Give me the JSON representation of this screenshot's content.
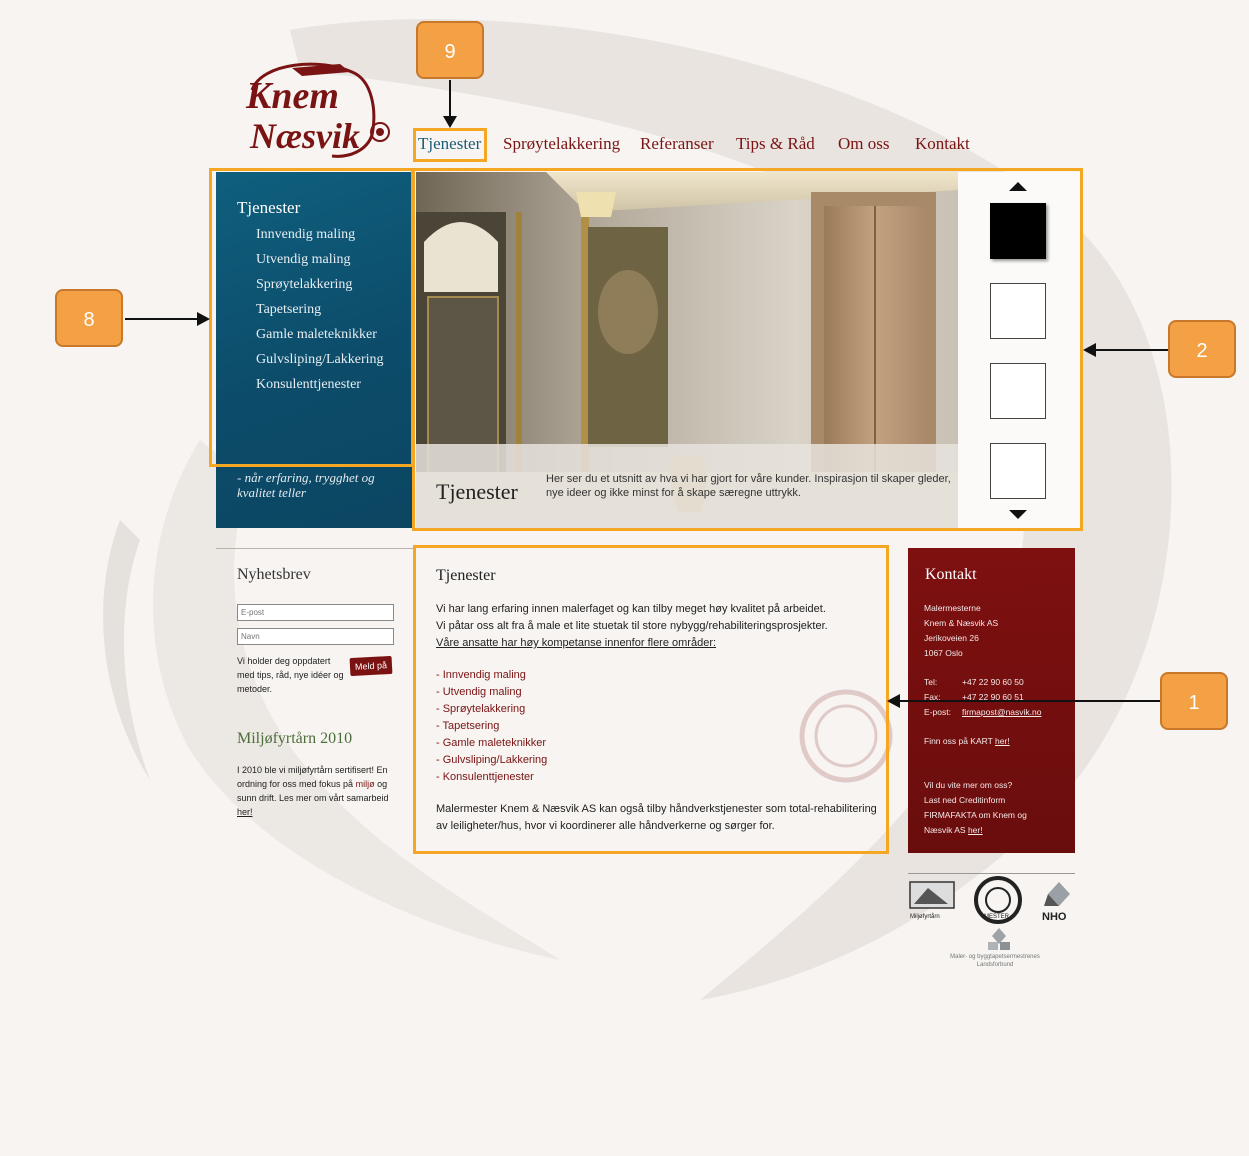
{
  "brand": {
    "logo_line1": "Knem",
    "logo_line2": "Næsvik"
  },
  "nav": [
    {
      "label": "Tjenester",
      "active": true
    },
    {
      "label": "Sprøytelakkering"
    },
    {
      "label": "Referanser"
    },
    {
      "label": "Tips & Råd"
    },
    {
      "label": "Om oss"
    },
    {
      "label": "Kontakt"
    }
  ],
  "sidenav": {
    "title": "Tjenester",
    "items": [
      "Innvendig maling",
      "Utvendig maling",
      "Sprøytelakkering",
      "Tapetsering",
      "Gamle maleteknikker",
      "Gulvsliping/Lakkering",
      "Konsulenttjenester"
    ],
    "tagline": "- når erfaring, trygghet og kvalitet teller"
  },
  "hero": {
    "title": "Tjenester",
    "text": "Her ser du et utsnitt av hva vi har gjort for våre kunder. Inspirasjon til skaper gleder, nye ideer og ikke minst for å skape særegne uttrykk."
  },
  "newsletter": {
    "title": "Nyhetsbrev",
    "email_placeholder": "E-post",
    "name_placeholder": "Navn",
    "text": "Vi holder deg oppdatert med tips, råd, nye idéer og metoder.",
    "button": "Meld på"
  },
  "eco": {
    "title": "Miljøfyrtårn 2010",
    "text_a": "I 2010 ble vi miljøfyrtårn sertifisert! En ordning for oss med fokus på",
    "link_a": "miljø",
    "text_b": "og sunn drift. Les mer om vårt samarbeid",
    "link_b": "her!"
  },
  "main": {
    "title": "Tjenester",
    "intro1": "Vi har lang erfaring innen malerfaget og kan tilby meget høy kvalitet på arbeidet.",
    "intro2": "Vi påtar oss alt fra å male et lite stuetak til store nybygg/rehabiliteringsprosjekter.",
    "intro3": "Våre ansatte har høy kompetanse innenfor flere områder:",
    "list": [
      "- Innvendig maling",
      "- Utvendig maling",
      "- Sprøytelakkering",
      "- Tapetsering",
      "- Gamle maleteknikker",
      "- Gulvsliping/Lakkering",
      "- Konsulenttjenester"
    ],
    "outro": "Malermester Knem & Næsvik AS kan også tilby håndverkstjenester som total-rehabilitering av leiligheter/hus, hvor vi koordinerer alle håndverkerne og sørger for."
  },
  "contact": {
    "title": "Kontakt",
    "company1": "Malermesterne",
    "company2": "Knem & Næsvik AS",
    "street": "Jerikoveien 26",
    "city": "1067 Oslo",
    "tel_label": "Tel:",
    "tel": "+47 22 90 60 50",
    "fax_label": "Fax:",
    "fax": "+47 22 90 60 51",
    "email_label": "E-post:",
    "email": "firmapost@nasvik.no",
    "map_text": "Finn oss på KART",
    "map_link": "her!",
    "more1": "Vil du vite mer om oss?",
    "more2": "Last ned Creditinform",
    "more3": "FIRMAFAKTA om Knem og",
    "more4": "Næsvik AS",
    "more_link": "her!"
  },
  "partners": {
    "eco_label": "Miljøfyrtårn",
    "master_label": "MESTER",
    "nho": "NHO",
    "union_line1": "Maler- og byggtapetsermestrenes",
    "union_line2": "Landsforbund"
  },
  "annotations": [
    "9",
    "8",
    "2",
    "1"
  ],
  "colors": {
    "brand_red": "#7a1414",
    "nav_blue": "#1c5c7a",
    "side_teal": "#0c4c6a",
    "annotation": "#f5a623"
  }
}
